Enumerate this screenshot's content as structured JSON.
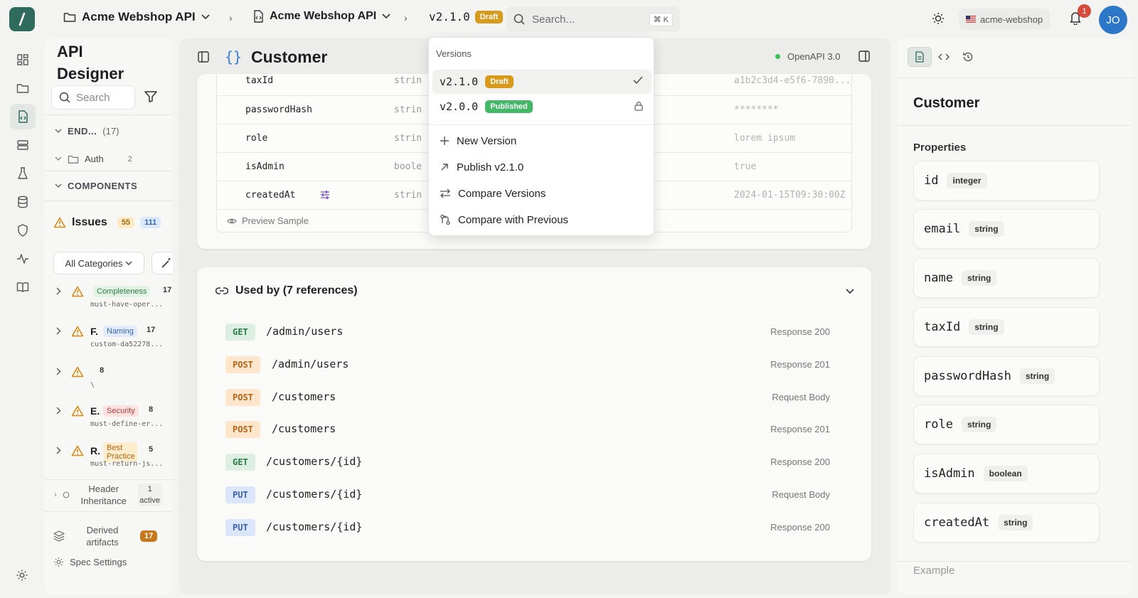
{
  "topbar": {
    "project": "Acme Webshop API",
    "spec": "Acme Webshop API",
    "version": "v2.1.0",
    "version_badge": "Draft",
    "search_placeholder": "Search...",
    "search_shortcut": "⌘ K",
    "workspace": "acme-webshop",
    "notifications": "1",
    "avatar": "JO"
  },
  "sidebar": {
    "title_line1": "API",
    "title_line2": "Designer",
    "search_placeholder": "Search",
    "endpoints_label": "END...",
    "endpoints_count": "(17)",
    "auth_label": "Auth",
    "auth_count": "2",
    "components_label": "COMPONENTS",
    "issues_label": "Issues",
    "issues_warn": "55",
    "issues_info": "111",
    "categories_label": "All Categories",
    "issues": [
      {
        "letter": "",
        "category": "Completeness",
        "count": "17",
        "rule": "must-have-oper..."
      },
      {
        "letter": "F.",
        "category": "Naming",
        "count": "17",
        "rule": "custom-da52278..."
      },
      {
        "letter": "",
        "category": "",
        "count": "8",
        "rule": "\\"
      },
      {
        "letter": "E.",
        "category": "Security",
        "count": "8",
        "rule": "must-define-er..."
      },
      {
        "letter": "R.",
        "category": "Best Practice",
        "count": "5",
        "rule": "must-return-js..."
      }
    ],
    "header_inheritance": "Header Inheritance",
    "header_inheritance_badge": "1 active",
    "derived_artifacts": "Derived artifacts",
    "derived_count": "17",
    "spec_settings": "Spec Settings"
  },
  "main": {
    "title": "Customer",
    "openapi": "OpenAPI 3.0",
    "fields": [
      {
        "name": "taxId",
        "type": "strin",
        "example": "a1b2c3d4-e5f6-7890..."
      },
      {
        "name": "passwordHash",
        "type": "strin",
        "example": "********"
      },
      {
        "name": "role",
        "type": "strin",
        "example": "lorem ipsum"
      },
      {
        "name": "isAdmin",
        "type": "boole",
        "example": "true"
      },
      {
        "name": "createdAt",
        "type": "strin",
        "example": "2024-01-15T09:30:00Z"
      }
    ],
    "preview_sample": "Preview Sample",
    "used_by_title": "Used by (7 references)",
    "references": [
      {
        "method": "GET",
        "path": "/admin/users",
        "where": "Response 200"
      },
      {
        "method": "POST",
        "path": "/admin/users",
        "where": "Response 201"
      },
      {
        "method": "POST",
        "path": "/customers",
        "where": "Request Body"
      },
      {
        "method": "POST",
        "path": "/customers",
        "where": "Response 201"
      },
      {
        "method": "GET",
        "path": "/customers/{id}",
        "where": "Response 200"
      },
      {
        "method": "PUT",
        "path": "/customers/{id}",
        "where": "Request Body"
      },
      {
        "method": "PUT",
        "path": "/customers/{id}",
        "where": "Response 200"
      }
    ]
  },
  "right": {
    "title": "Customer",
    "properties_label": "Properties",
    "properties": [
      {
        "name": "id",
        "type": "integer"
      },
      {
        "name": "email",
        "type": "string"
      },
      {
        "name": "name",
        "type": "string"
      },
      {
        "name": "taxId",
        "type": "string"
      },
      {
        "name": "passwordHash",
        "type": "string"
      },
      {
        "name": "role",
        "type": "string"
      },
      {
        "name": "isAdmin",
        "type": "boolean"
      },
      {
        "name": "createdAt",
        "type": "string"
      }
    ],
    "example_label": "Example"
  },
  "versions_menu": {
    "header": "Versions",
    "items": [
      {
        "version": "v2.1.0",
        "badge": "Draft"
      },
      {
        "version": "v2.0.0",
        "badge": "Published"
      }
    ],
    "new_version": "New Version",
    "publish": "Publish v2.1.0",
    "compare_versions": "Compare Versions",
    "compare_previous": "Compare with Previous"
  },
  "colors": {
    "brand": "#2f6b5c",
    "draft": "#d89a1a",
    "published": "#43b866",
    "accent": "#3b7be0"
  }
}
